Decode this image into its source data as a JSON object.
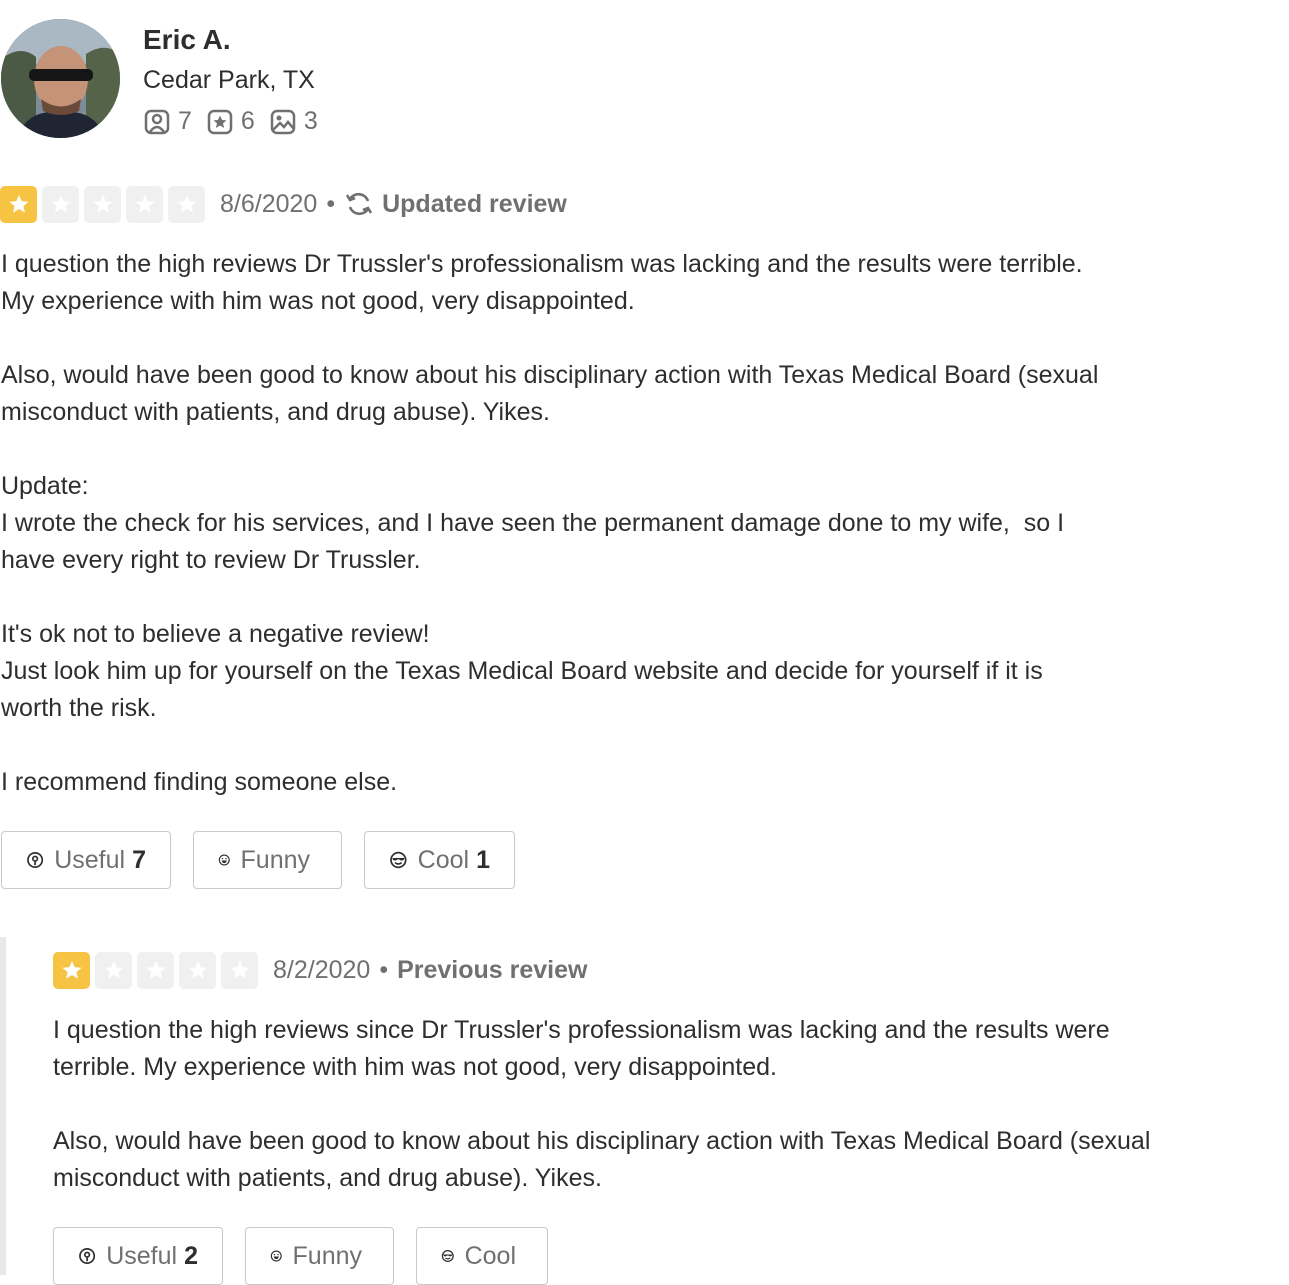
{
  "user": {
    "name": "Eric A.",
    "location": "Cedar Park, TX",
    "stats": {
      "friends": "7",
      "reviews": "6",
      "photos": "3"
    }
  },
  "review": {
    "rating": 1,
    "date": "8/6/2020",
    "separator": "•",
    "status": "Updated review",
    "text": "I question the high reviews Dr Trussler's professionalism was lacking and the results were terrible.\nMy experience with him was not good, very disappointed.\n\nAlso, would have been good to know about his disciplinary action with Texas Medical Board (sexual\nmisconduct with patients, and drug abuse). Yikes.\n\nUpdate:\nI wrote the check for his services, and I have seen the permanent damage done to my wife,  so I\nhave every right to review Dr Trussler.\n\nIt's ok not to believe a negative review!\nJust look him up for yourself on the Texas Medical Board website and decide for yourself if it is\nworth the risk.\n\nI recommend finding someone else.",
    "useful_label": "Useful",
    "useful_count": "7",
    "funny_label": "Funny",
    "funny_count": "",
    "cool_label": "Cool",
    "cool_count": "1"
  },
  "previous_review": {
    "rating": 1,
    "date": "8/2/2020",
    "separator": "•",
    "status": "Previous review",
    "text": "I question the high reviews since Dr Trussler's professionalism was lacking and the results were\nterrible. My experience with him was not good, very disappointed.\n\nAlso, would have been good to know about his disciplinary action with Texas Medical Board (sexual\nmisconduct with patients, and drug abuse). Yikes.",
    "useful_label": "Useful",
    "useful_count": "2",
    "funny_label": "Funny",
    "funny_count": "",
    "cool_label": "Cool",
    "cool_count": ""
  },
  "colors": {
    "star_on": "#f6c343",
    "star_off": "#f0f0f0",
    "muted_text": "#6e7072"
  }
}
